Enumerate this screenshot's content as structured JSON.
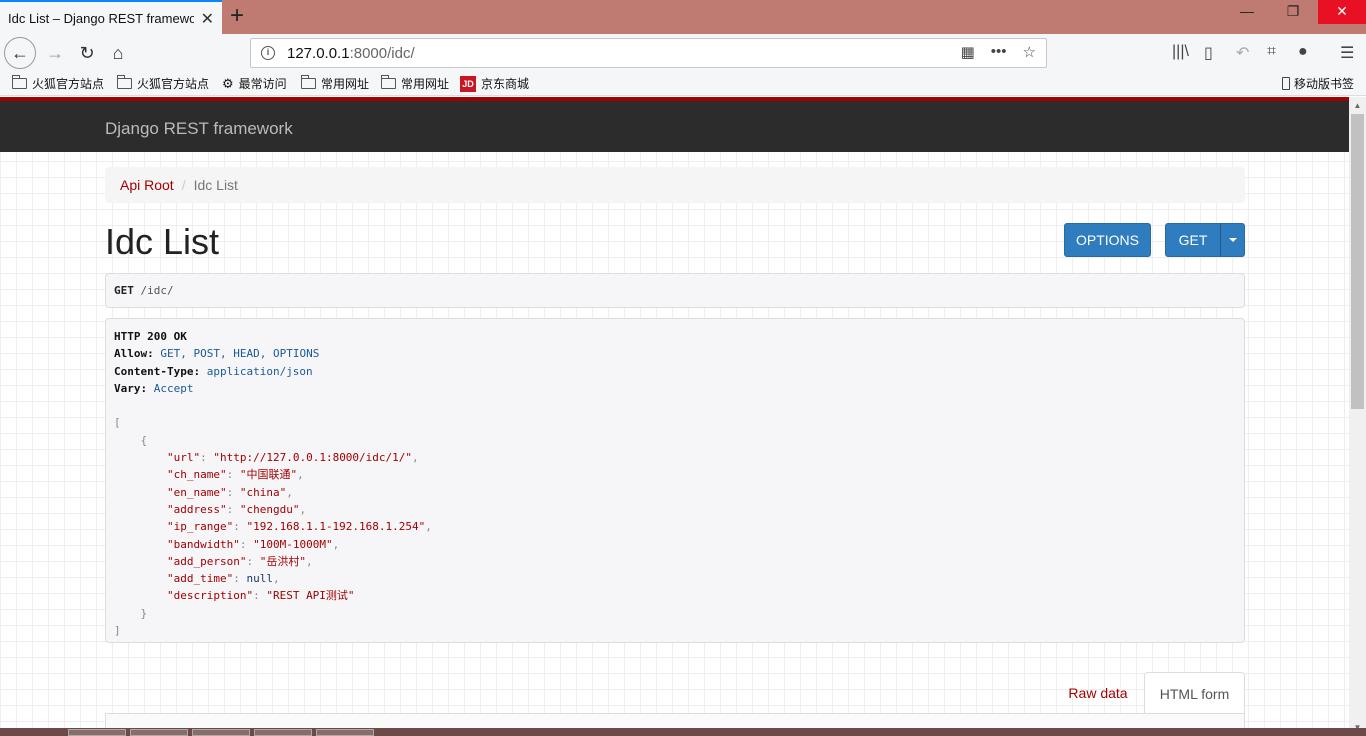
{
  "browser": {
    "tab_title": "Idc List – Django REST framewor",
    "tab_close": "✕",
    "new_tab": "+",
    "url_host": "127.0.0.1",
    "url_rest": ":8000/idc/",
    "bookmarks": [
      "火狐官方站点",
      "火狐官方站点",
      "最常访问",
      "常用网址",
      "常用网址",
      "京东商城"
    ],
    "jd_badge": "JD",
    "mobile_bookmarks": "移动版书签"
  },
  "page": {
    "brand": "Django REST framework",
    "breadcrumb": {
      "root": "Api Root",
      "separator": "/",
      "current": "Idc List"
    },
    "title": "Idc List",
    "buttons": {
      "options": "OPTIONS",
      "get": "GET"
    },
    "request": {
      "method": "GET",
      "path": "/idc/"
    },
    "response": {
      "status": "HTTP 200 OK",
      "headers": [
        {
          "key": "Allow:",
          "value": "GET, POST, HEAD, OPTIONS"
        },
        {
          "key": "Content-Type:",
          "value": "application/json"
        },
        {
          "key": "Vary:",
          "value": "Accept"
        }
      ],
      "json": {
        "open_bracket": "[",
        "open_brace": "{",
        "fields": [
          {
            "key": "\"url\"",
            "value": "\"http://127.0.0.1:8000/idc/1/\"",
            "type": "str"
          },
          {
            "key": "\"ch_name\"",
            "value": "\"中国联通\"",
            "type": "str"
          },
          {
            "key": "\"en_name\"",
            "value": "\"china\"",
            "type": "str"
          },
          {
            "key": "\"address\"",
            "value": "\"chengdu\"",
            "type": "str"
          },
          {
            "key": "\"ip_range\"",
            "value": "\"192.168.1.1-192.168.1.254\"",
            "type": "str"
          },
          {
            "key": "\"bandwidth\"",
            "value": "\"100M-1000M\"",
            "type": "str"
          },
          {
            "key": "\"add_person\"",
            "value": "\"岳洪村\"",
            "type": "str"
          },
          {
            "key": "\"add_time\"",
            "value": "null",
            "type": "null"
          },
          {
            "key": "\"description\"",
            "value": "\"REST API测试\"",
            "type": "str"
          }
        ],
        "close_brace": "}",
        "close_bracket": "]"
      }
    },
    "form_tabs": {
      "raw": "Raw data",
      "html": "HTML form"
    }
  },
  "colors": {
    "accent": "#a30000",
    "button": "#2f7cbf",
    "navbar": "#2c2c2c"
  }
}
